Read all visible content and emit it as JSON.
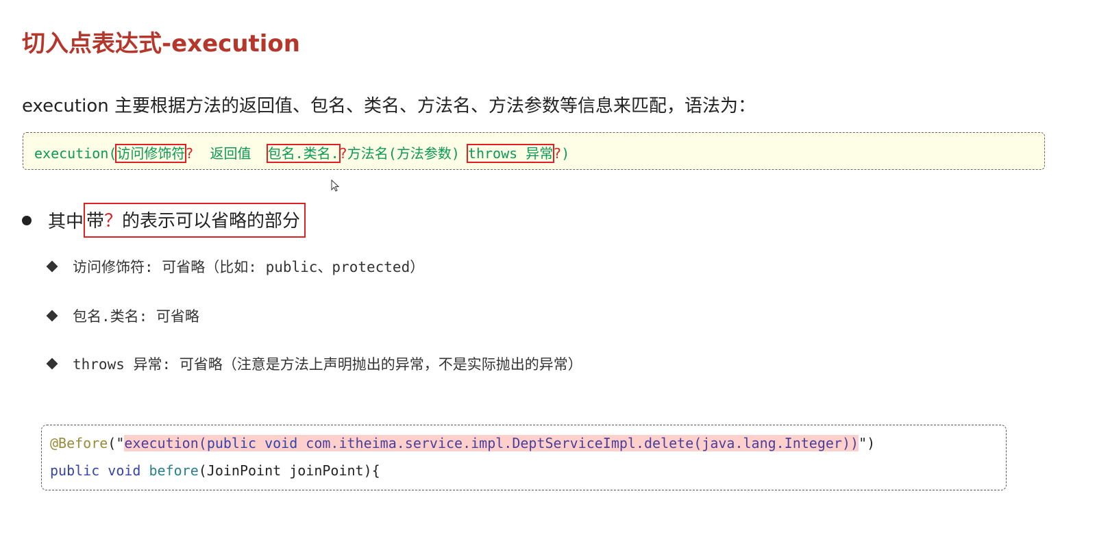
{
  "title": "切入点表达式-execution",
  "intro": "execution 主要根据方法的返回值、包名、类名、方法名、方法参数等信息来匹配，语法为：",
  "syntax": {
    "p1": "execution(",
    "access": "访问修饰符",
    "q1": "?",
    "p2": "  返回值  ",
    "pkg": "包名.类名.",
    "q2": "?",
    "p3": "方法名(方法参数) ",
    "throws": "throws 异常",
    "q3": "?",
    "p4": ")"
  },
  "bullet": {
    "prefix": "其中",
    "hl1": "带",
    "q": "？",
    "hl2": "的表示可以省略的部分"
  },
  "subs": [
    {
      "label": "访问修饰符: 可省略（比如: public、protected）"
    },
    {
      "label": "包名.类名:  可省略"
    },
    {
      "label": "throws 异常: 可省略（注意是方法上声明抛出的异常，不是实际抛出的异常）"
    }
  ],
  "code": {
    "ann": "@Before",
    "open": "(\"",
    "expr_start": "execution(",
    "kw1": "public void",
    "expr_rest": " com.itheima.service.impl.DeptServiceImpl.delete(java.lang.Integer))",
    "close_q": "\"",
    "close": ")",
    "l2_kw": "public void",
    "l2_fn": " before",
    "l2_rest": "(JoinPoint joinPoint){"
  }
}
